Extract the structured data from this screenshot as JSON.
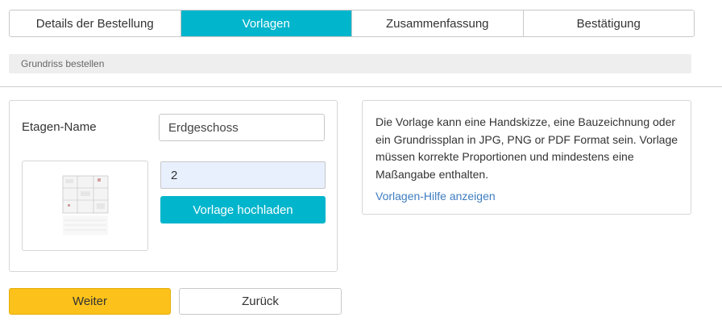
{
  "steps": [
    {
      "label": "Details der Bestellung",
      "active": false
    },
    {
      "label": "Vorlagen",
      "active": true
    },
    {
      "label": "Zusammenfassung",
      "active": false
    },
    {
      "label": "Bestätigung",
      "active": false
    }
  ],
  "breadcrumb": {
    "label": "Grundriss bestellen"
  },
  "floor": {
    "name_label": "Etagen-Name",
    "name_value": "Erdgeschoss",
    "thumbnail_icon": "floor-plan-thumbnail",
    "count_value": "2",
    "upload_label": "Vorlage hochladen"
  },
  "info": {
    "text": "Die Vorlage kann eine Handskizze, eine Bauzeichnung oder ein Grundrissplan in JPG, PNG or PDF Format sein. Vorlage müssen korrekte Proportionen und mindestens eine Maßangabe enthalten.",
    "link_label": "Vorlagen-Hilfe anzeigen"
  },
  "actions": {
    "next_label": "Weiter",
    "back_label": "Zurück"
  },
  "colors": {
    "accent": "#00b5cc",
    "primary_button": "#fcc21b",
    "link": "#3d7cbf"
  }
}
